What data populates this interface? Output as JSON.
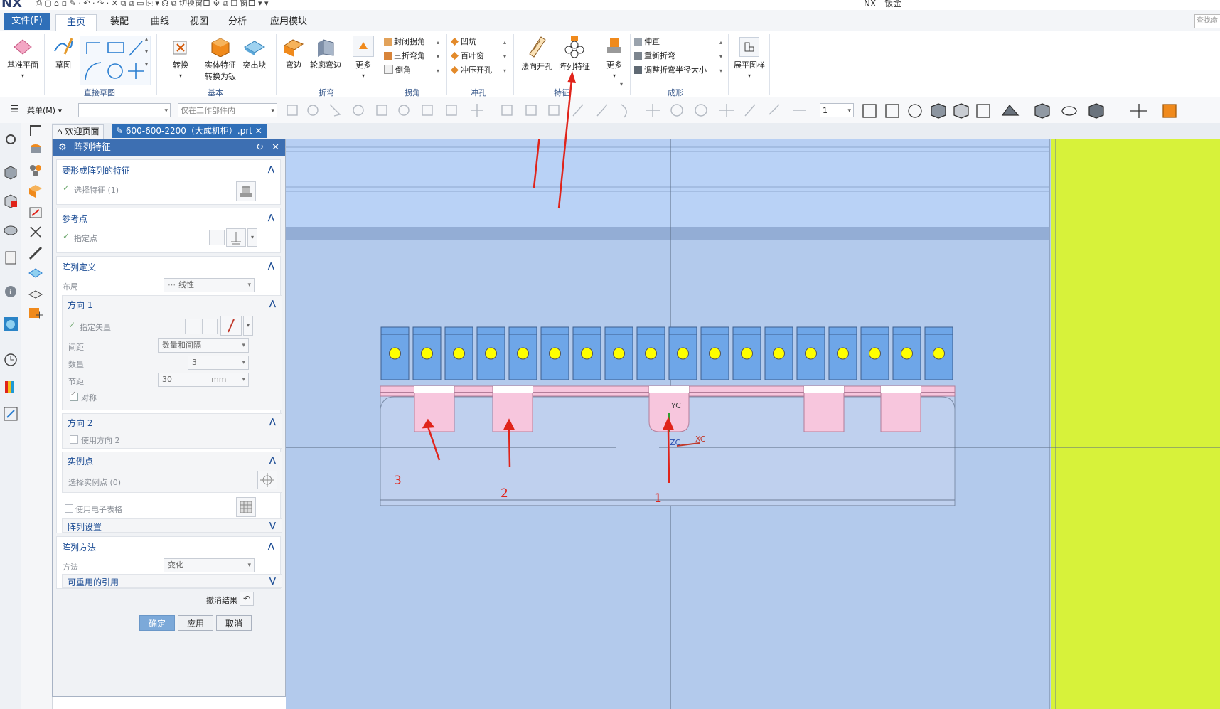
{
  "titlebar": {
    "logo": "NX",
    "quick_access": "⎙ ▢ ⌂ ▫ ✎ · ↶ · ↷ · ✕  ⧉ ⧉ ▭ ⎘ ▾  ☊  ⧉ 切换窗口 ⚙ ⧉ ☐ 窗口 ▾  ▾",
    "title": "NX - 钣金"
  },
  "menu": {
    "file": "文件(F)",
    "tabs": [
      "主页",
      "装配",
      "曲线",
      "视图",
      "分析",
      "应用模块"
    ],
    "active_tab": "主页",
    "search_placeholder": "查找命"
  },
  "ribbon": {
    "datum_plane": "基准平面",
    "sketch": "草图",
    "direct_sketch_group": "直接草图",
    "convert": "转换",
    "solid_to_sheet_line1": "实体特征",
    "solid_to_sheet_line2": "转换为钣",
    "tab": "突出块",
    "basic_group": "基本",
    "flange": "弯边",
    "contour_flange": "轮廓弯边",
    "more1": "更多",
    "bend_group": "折弯",
    "closed_corner": "封闭拐角",
    "three_bend_corner": "三折弯角",
    "chamfer": "倒角",
    "corner_group": "拐角",
    "dimple": "凹坑",
    "louver": "百叶窗",
    "drawn_cutout": "冲压开孔",
    "punch_group": "冲孔",
    "normal_cutout": "法向开孔",
    "pattern_feature": "阵列特征",
    "more2": "更多",
    "feature_group": "特征",
    "unbend": "伸直",
    "rebend": "重新折弯",
    "adjust_bend_radius": "调整折弯半径大小",
    "form_group": "成形",
    "flat_pattern": "展平图样"
  },
  "toolbar2": {
    "menu_label": "菜单(M)",
    "filter_combo": "",
    "scope_combo": "仅在工作部件内",
    "layer_value": "1"
  },
  "tabs": {
    "welcome": "欢迎页面",
    "part": "600-600-2200（大成机柜）.prt"
  },
  "dialog": {
    "title": "阵列特征",
    "sec_features": {
      "header": "要形成阵列的特征",
      "select": "选择特征 (1)"
    },
    "sec_ref": {
      "header": "参考点",
      "specify": "指定点"
    },
    "sec_def": {
      "header": "阵列定义",
      "layout_label": "布局",
      "layout_value": "线性",
      "dir1": {
        "header": "方向 1",
        "vector": "指定矢量",
        "spacing_label": "间距",
        "spacing_value": "数量和间隔",
        "count_label": "数量",
        "count_value": "3",
        "pitch_label": "节距",
        "pitch_value": "30",
        "pitch_unit": "mm",
        "symmetric": "对称"
      },
      "dir2": {
        "header": "方向 2",
        "use": "使用方向 2"
      },
      "instance": {
        "header": "实例点",
        "select": "选择实例点 (0)"
      },
      "spreadsheet": "使用电子表格",
      "settings": "阵列设置"
    },
    "sec_method": {
      "header": "阵列方法",
      "method_label": "方法",
      "method_value": "变化",
      "reusable": "可重用的引用"
    },
    "undo_result": "撤消结果",
    "buttons": {
      "ok": "确定",
      "apply": "应用",
      "cancel": "取消"
    }
  },
  "viewport": {
    "axis_labels": {
      "yc": "YC",
      "xc": "XC",
      "zc": "ZC"
    },
    "annotations": [
      "3",
      "2",
      "1"
    ],
    "colors": {
      "background": "#b7cff3",
      "panel": "#dfe9f9",
      "yellow_panel": "#d7f23a",
      "tabs": "#f7c6dd",
      "connectors": "#6ea6e8",
      "dots": "#ffff00",
      "arrows": "#e0241b"
    }
  }
}
